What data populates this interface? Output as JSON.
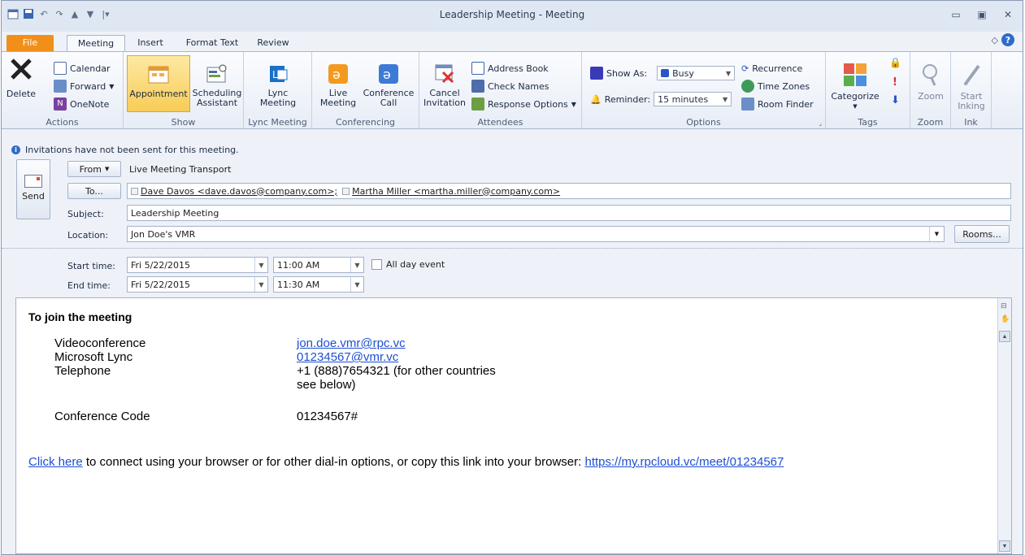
{
  "window": {
    "title": "Leadership Meeting - Meeting"
  },
  "tabs": [
    "File",
    "Meeting",
    "Insert",
    "Format Text",
    "Review"
  ],
  "ribbon": {
    "actions": {
      "label": "Actions",
      "delete": "Delete",
      "calendar": "Calendar",
      "forward": "Forward",
      "onenote": "OneNote"
    },
    "show": {
      "label": "Show",
      "appointment": "Appointment",
      "scheduling_1": "Scheduling",
      "scheduling_2": "Assistant"
    },
    "lync": {
      "label": "Lync Meeting",
      "btn_1": "Lync",
      "btn_2": "Meeting"
    },
    "conferencing": {
      "label": "Conferencing",
      "live_1": "Live",
      "live_2": "Meeting",
      "conf_1": "Conference",
      "conf_2": "Call"
    },
    "attendees": {
      "label": "Attendees",
      "cancel_1": "Cancel",
      "cancel_2": "Invitation",
      "address_book": "Address Book",
      "check_names": "Check Names",
      "response_options": "Response Options"
    },
    "options": {
      "label": "Options",
      "show_as_label": "Show As:",
      "show_as_value": "Busy",
      "reminder_label": "Reminder:",
      "reminder_value": "15 minutes",
      "recurrence": "Recurrence",
      "time_zones": "Time Zones",
      "room_finder": "Room Finder"
    },
    "tags": {
      "label": "Tags",
      "categorize": "Categorize"
    },
    "zoom": {
      "label": "Zoom",
      "btn": "Zoom"
    },
    "ink": {
      "label": "Ink",
      "btn_1": "Start",
      "btn_2": "Inking"
    }
  },
  "form": {
    "info": "Invitations have not been sent for this meeting.",
    "send": "Send",
    "from_button": "From",
    "from_value": "Live Meeting Transport",
    "to_button": "To...",
    "recipients": [
      "Dave Davos <dave.davos@company.com>;",
      "Martha Miller <martha.miller@company.com>"
    ],
    "subject_label": "Subject:",
    "subject_value": "Leadership Meeting",
    "location_label": "Location:",
    "location_value": "Jon Doe's VMR",
    "rooms_button": "Rooms...",
    "start_label": "Start time:",
    "start_date": "Fri 5/22/2015",
    "start_time": "11:00 AM",
    "all_day": "All day event",
    "end_label": "End time:",
    "end_date": "Fri 5/22/2015",
    "end_time": "11:30 AM"
  },
  "body": {
    "heading": "To join the meeting",
    "rows": [
      {
        "label": "Videoconference",
        "value": "jon.doe.vmr@rpc.vc"
      },
      {
        "label": "Microsoft Lync",
        "value": "01234567@vmr.vc"
      },
      {
        "label": "Telephone",
        "value": "+1 (888)7654321 (for other countries",
        "value_2": "see below)"
      },
      {
        "label": "Conference Code",
        "value": "01234567#"
      }
    ],
    "click_here": "Click here",
    "bottom_text": " to connect using your browser or for other dial-in options, or copy this link into your browser: ",
    "bottom_link": "https://my.rpcloud.vc/meet/01234567"
  }
}
